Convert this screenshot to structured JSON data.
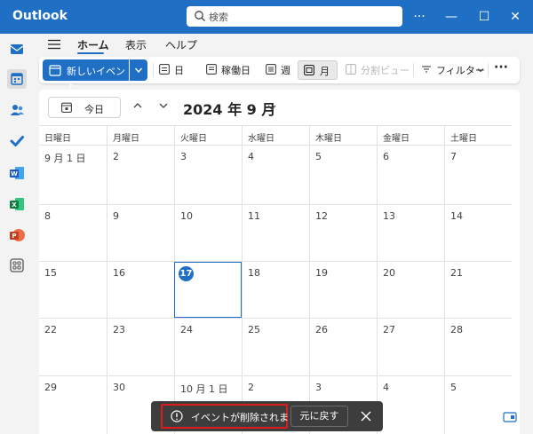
{
  "app": {
    "name": "Outlook"
  },
  "search": {
    "placeholder": "検索"
  },
  "window": {
    "more": "···",
    "minimize": "—",
    "maximize": "☐",
    "close": "✕"
  },
  "ribbon": {
    "tabs": [
      "ホーム",
      "表示",
      "ヘルプ"
    ],
    "active_tab": "ホーム"
  },
  "toolbar": {
    "new_event": "新しいイベント",
    "day": "日",
    "work_week": "稼働日",
    "week": "週",
    "month": "月",
    "split_view": "分割ビュー",
    "filter": "フィルター",
    "more": "···"
  },
  "calendar": {
    "today_button": "今日",
    "title": "2024 年 9 月",
    "weekdays": [
      "日曜日",
      "月曜日",
      "火曜日",
      "水曜日",
      "木曜日",
      "金曜日",
      "土曜日"
    ],
    "weeks": [
      [
        "9 月 1 日",
        "2",
        "3",
        "4",
        "5",
        "6",
        "7"
      ],
      [
        "8",
        "9",
        "10",
        "11",
        "12",
        "13",
        "14"
      ],
      [
        "15",
        "16",
        "17",
        "18",
        "19",
        "20",
        "21"
      ],
      [
        "22",
        "23",
        "24",
        "25",
        "26",
        "27",
        "28"
      ],
      [
        "29",
        "30",
        "10 月 1 日",
        "2",
        "3",
        "4",
        "5"
      ]
    ],
    "today": "17"
  },
  "toast": {
    "message": "イベントが削除されました",
    "undo": "元に戻す"
  },
  "colors": {
    "accent": "#1f6fc5",
    "highlight": "#e0191e",
    "toast_bg": "#3d3d3d"
  }
}
